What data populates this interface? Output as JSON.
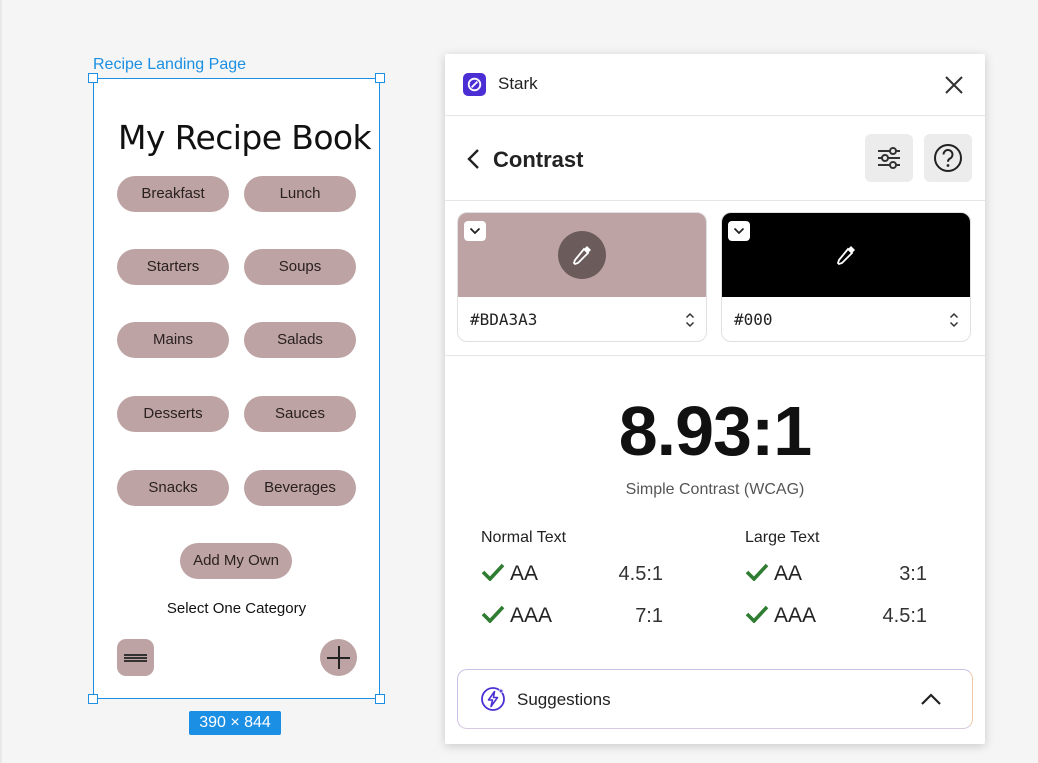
{
  "canvas": {
    "frame_label": "Recipe Landing Page",
    "size_badge": "390 × 844"
  },
  "recipe": {
    "title": "My Recipe Book",
    "categories": [
      "Breakfast",
      "Lunch",
      "Starters",
      "Soups",
      "Mains",
      "Salads",
      "Desserts",
      "Sauces",
      "Snacks",
      "Beverages"
    ],
    "add_button": "Add My Own",
    "hint": "Select One Category",
    "pill_color": "#BDA3A3"
  },
  "stark": {
    "app_name": "Stark",
    "logo_color": "#4B2FD4",
    "page_title": "Contrast",
    "foreground": {
      "hex": "#BDA3A3",
      "color": "#bda3a3"
    },
    "background": {
      "hex": "#000",
      "color": "#000000"
    },
    "ratio": "8.93:1",
    "ratio_caption": "Simple Contrast (WCAG)",
    "normal_text": {
      "heading": "Normal Text",
      "rows": [
        {
          "level": "AA",
          "required": "4.5:1",
          "pass": true
        },
        {
          "level": "AAA",
          "required": "7:1",
          "pass": true
        }
      ]
    },
    "large_text": {
      "heading": "Large Text",
      "rows": [
        {
          "level": "AA",
          "required": "3:1",
          "pass": true
        },
        {
          "level": "AAA",
          "required": "4.5:1",
          "pass": true
        }
      ]
    },
    "pass_color": "#2e7d32",
    "suggestions_label": "Suggestions"
  }
}
